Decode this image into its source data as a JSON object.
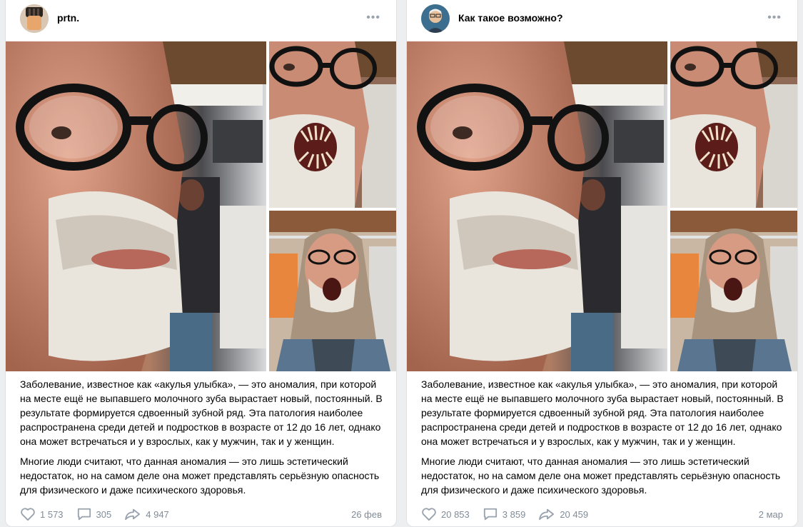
{
  "posts": [
    {
      "author": "prtn.",
      "avatar_icon": "avatar-ceramic-cup",
      "text": [
        "Заболевание, известное как «акулья улыбка», — это аномалия, при которой на месте ещё не выпавшего молочного зуба вырастает новый, постоянный. В результате формируется сдвоенный зубной ряд. Эта патология наиболее распространена среди детей и подростков в возрасте от 12 до 16 лет, однако она может встречаться и у взрослых, как у мужчин, так и у женщин.",
        "Многие люди считают, что данная аномалия — это лишь эстетический недостаток, но на самом деле она может представлять серьёзную опасность для физического и даже психического здоровья."
      ],
      "likes": "1 573",
      "comments": "305",
      "shares": "4 947",
      "date": "26 фев"
    },
    {
      "author": "Как такое возможно?",
      "avatar_icon": "avatar-cartoon-man",
      "text": [
        "Заболевание, известное как «акулья улыбка», — это аномалия, при которой на месте ещё не выпавшего молочного зуба вырастает новый, постоянный. В результате формируется сдвоенный зубной ряд. Эта патология наиболее распространена среди детей и подростков в возрасте от 12 до 16 лет, однако она может встречаться и у взрослых, как у мужчин, так и у женщин.",
        "Многие люди считают, что данная аномалия — это лишь эстетический недостаток, но на самом деле она может представлять серьёзную опасность для физического и даже психического здоровья."
      ],
      "likes": "20 853",
      "comments": "3 859",
      "shares": "20 459",
      "date": "2 мар"
    }
  ],
  "colors": {
    "page_bg": "#edeef0",
    "card_bg": "#ffffff",
    "muted": "#818c99"
  },
  "icons": [
    "more-dots-icon",
    "heart-icon",
    "comment-icon",
    "share-icon"
  ]
}
